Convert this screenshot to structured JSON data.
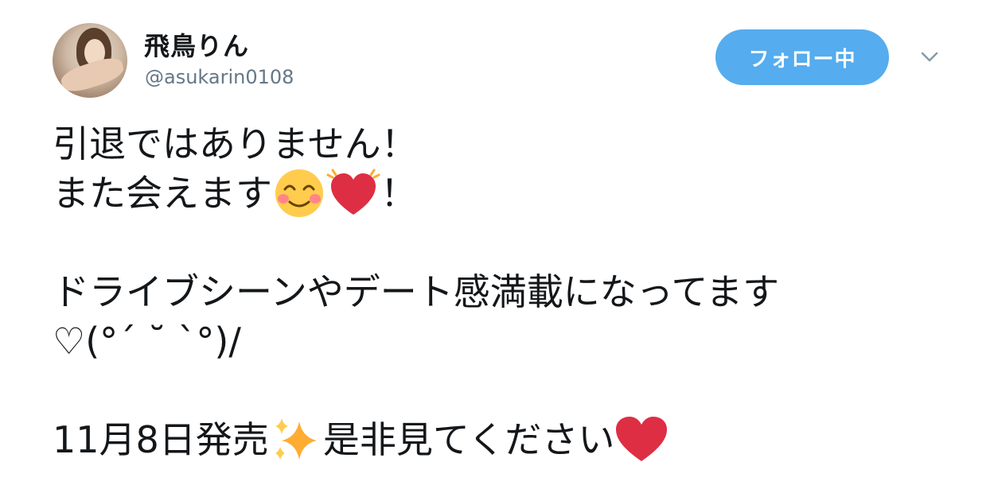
{
  "tweet": {
    "display_name": "飛鳥りん",
    "handle": "@asukarin0108",
    "follow_label": "フォロー中",
    "text": {
      "line1": "引退ではありません！",
      "line2_a": "また会えます",
      "line2_b": "！",
      "line3": "ドライブシーンやデート感満載になってます",
      "line4": "♡(°´ ˘ `°)/",
      "line5_a": "11月8日発売",
      "line5_b": "是非見てください"
    },
    "emojis": [
      "smiling-face-icon",
      "beating-heart-icon",
      "sparkles-icon",
      "red-heart-icon"
    ],
    "colors": {
      "follow_button": "#55acee",
      "handle_text": "#657786",
      "heart": "#dd2e44"
    }
  }
}
